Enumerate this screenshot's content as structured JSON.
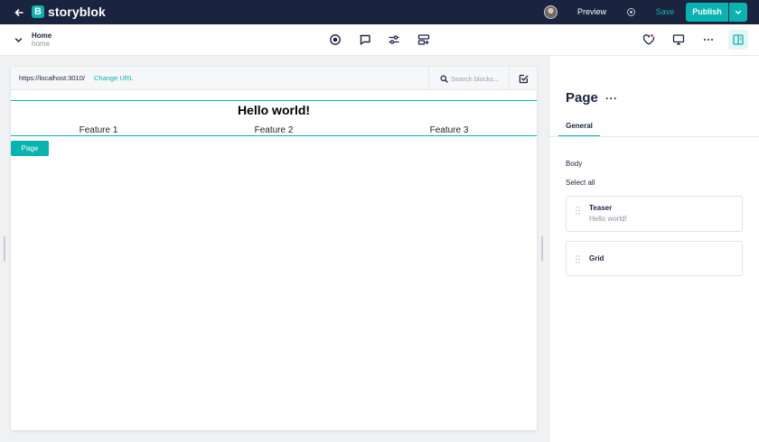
{
  "topbar": {
    "brand": "storyblok",
    "brand_letter": "B",
    "preview_label": "Preview",
    "save_label": "Save",
    "publish_label": "Publish"
  },
  "breadcrumb": {
    "title": "Home",
    "slug": "home"
  },
  "urlbar": {
    "url": "https://localhost:3010/",
    "change_url_label": "Change URL",
    "search_placeholder": "Search blocks..."
  },
  "preview": {
    "heading": "Hello world!",
    "features": [
      "Feature 1",
      "Feature 2",
      "Feature 3"
    ],
    "page_tag": "Page"
  },
  "panel": {
    "title": "Page",
    "more_label": "···",
    "tabs": [
      {
        "label": "General",
        "active": true
      }
    ],
    "field_label": "Body",
    "select_all_label": "Select all",
    "bloks": [
      {
        "name": "Teaser",
        "subtitle": "Hello world!"
      },
      {
        "name": "Grid",
        "subtitle": ""
      }
    ]
  },
  "colors": {
    "topbar_bg": "#1b243f",
    "accent": "#09b3af",
    "notification_dot": "#e34d4d"
  }
}
